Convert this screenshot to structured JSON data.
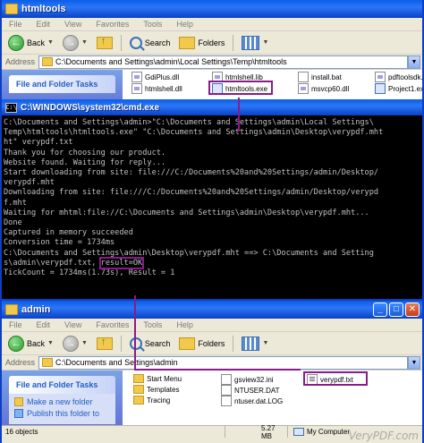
{
  "top_window": {
    "title": "htmltools",
    "menu": [
      "File",
      "Edit",
      "View",
      "Favorites",
      "Tools",
      "Help"
    ],
    "toolbar": {
      "back": "Back",
      "search": "Search",
      "folders": "Folders"
    },
    "address_label": "Address",
    "address_path": "C:\\Documents and Settings\\admin\\Local Settings\\Temp\\htmltools",
    "task_header": "File and Folder Tasks",
    "files": [
      "GdiPlus.dll",
      "htmlshell.lib",
      "install.bat",
      "pdftoolsdk.",
      "htmlshell.dll",
      "htmltools.exe",
      "msvcp60.dll",
      "Project1.ex"
    ]
  },
  "cmd_window": {
    "title": "C:\\WINDOWS\\system32\\cmd.exe",
    "lines": [
      "C:\\Documents and Settings\\admin>\"C:\\Documents and Settings\\admin\\Local Settings\\",
      "Temp\\htmltools\\htmltools.exe\" \"C:\\Documents and Settings\\admin\\Desktop\\verypdf.mht",
      "ht\" verypdf.txt",
      "Thank you for choosing our product.",
      "Website found. Waiting for reply...",
      "Start downloading from site: file:///C:/Documents%20and%20Settings/admin/Desktop/",
      "verypdf.mht",
      "Downloading from site: file:///C:/Documents%20and%20Settings/admin/Desktop/verypd",
      "f.mht",
      "Waiting for mhtml:file://C:\\Documents and Settings\\admin\\Desktop\\verypdf.mht...",
      "Done",
      "Captured in memory succeeded",
      "Conversion time = 1734ms",
      "C:\\Documents and Settings\\admin\\Desktop\\verypdf.mht ==> C:\\Documents and Setting",
      "s\\admin\\verypdf.txt, ",
      "TickCount = 1734ms(1.73s), Result = 1"
    ],
    "result_text": "result=OK"
  },
  "bottom_window": {
    "title": "admin",
    "menu": [
      "File",
      "Edit",
      "View",
      "Favorites",
      "Tools",
      "Help"
    ],
    "toolbar": {
      "back": "Back",
      "search": "Search",
      "folders": "Folders"
    },
    "address_label": "Address",
    "address_path": "C:\\Documents and Settings\\admin",
    "task_header": "File and Folder Tasks",
    "tasks": [
      "Make a new folder",
      "Publish this folder to"
    ],
    "files": [
      "Start Menu",
      "gsview32.ini",
      "verypdf.txt",
      "Templates",
      "NTUSER.DAT",
      "Tracing",
      "ntuser.dat.LOG"
    ],
    "status": {
      "objects": "16 objects",
      "size": "5.27 MB",
      "location": "My Computer"
    },
    "watermark": "VeryPDF.com"
  }
}
